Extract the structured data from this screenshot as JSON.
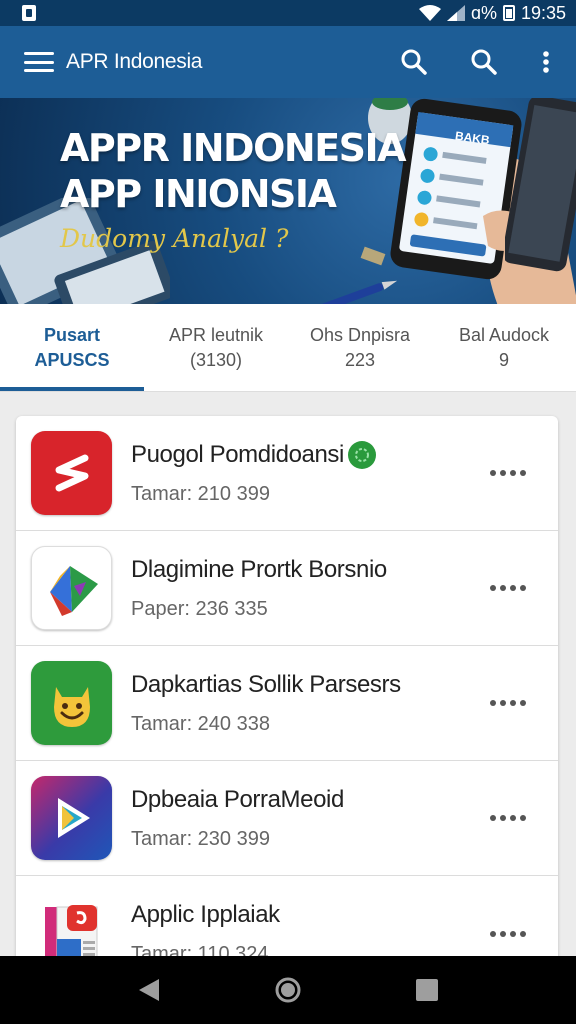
{
  "status_bar": {
    "battery": "ɑ%",
    "time": "19:35"
  },
  "toolbar": {
    "title": "APR Indonesia",
    "icons": [
      "menu-icon",
      "search-icon",
      "search-icon",
      "more-vert-icon"
    ]
  },
  "banner": {
    "line1": "APPR INDONESIA",
    "line2": "APP INIONSIA",
    "tagline": "Dudomy Analyal ?",
    "phone_label": "BAKB"
  },
  "tabs": [
    {
      "line1": "Pusart",
      "line2": "APUSCS",
      "active": true
    },
    {
      "line1": "APR leutnik",
      "line2": "(3130)",
      "active": false
    },
    {
      "line1": "Ohs Dnpisra",
      "line2": "223",
      "active": false
    },
    {
      "line1": "Bal Audock",
      "line2": "9",
      "active": false
    }
  ],
  "apps": [
    {
      "title": "Puogol Pomdidoansi",
      "subtitle": "Tamar: 210 399",
      "icon": "red-s-logo-icon",
      "verified": true
    },
    {
      "title": "Dlagimine Prortk Borsnio",
      "subtitle": "Paper: 236 335",
      "icon": "triangle-logo-icon",
      "verified": false
    },
    {
      "title": "Dapkartias Sollik Parsesrs",
      "subtitle": "Tamar: 240 338",
      "icon": "smiley-logo-icon",
      "verified": false
    },
    {
      "title": "Dpbeaia PorraMeoid",
      "subtitle": "Tamar: 230 399",
      "icon": "play-logo-icon",
      "verified": false
    },
    {
      "title": "Applic Ipplaiak",
      "subtitle": "Tamar: 110 324",
      "icon": "document-logo-icon",
      "verified": false
    }
  ],
  "colors": {
    "toolbar": "#1d5d96",
    "status_bar": "#0c3a63",
    "accent": "#1d5d96"
  }
}
